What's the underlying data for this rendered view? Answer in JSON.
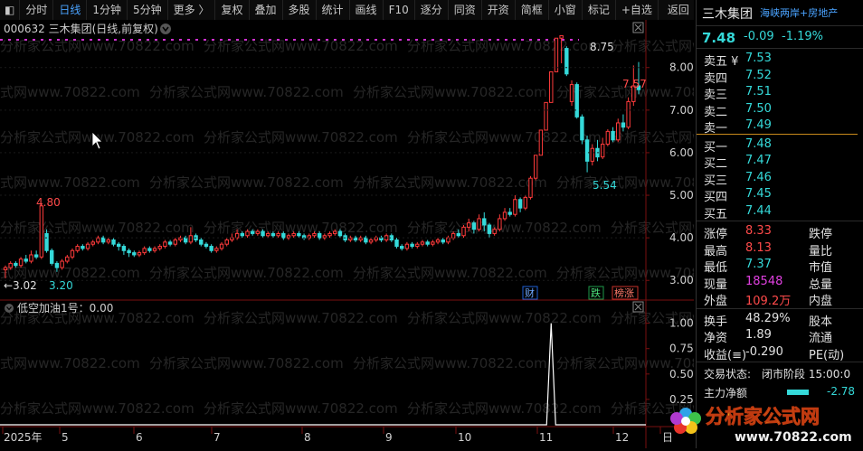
{
  "toolbar": {
    "items": [
      "分时",
      "日线",
      "1分钟",
      "5分钟",
      "更多 〉",
      "复权",
      "叠加",
      "多股",
      "统计",
      "画线",
      "F10",
      "逐分",
      "同资",
      "开资",
      "简框",
      "小窗",
      "标记",
      "+自选",
      "返回"
    ],
    "active": "日线"
  },
  "header": {
    "code_line": "000632 三木集团(日线,前复权)",
    "indicator_line": "低空加油1号：0.00"
  },
  "watermark": "分析家公式网www.70822.com",
  "chart_data": {
    "type": "candlestick",
    "price_axis": {
      "ticks": [
        "8.00",
        "7.00",
        "6.00",
        "5.00",
        "4.00",
        "3.00"
      ],
      "range": [
        2.75,
        8.95
      ]
    },
    "indicator_axis": {
      "ticks": [
        "1.00",
        "0.75",
        "0.50",
        "0.25"
      ],
      "range": [
        0,
        1.05
      ]
    },
    "x_labels": [
      "2025年",
      "5",
      "6",
      "7",
      "8",
      "9",
      "10",
      "11",
      "12",
      "日"
    ],
    "annotations": {
      "high": "8.75",
      "peak_low": "5.54",
      "last": "7.57",
      "early_high": "4.80",
      "early_low": "3.20",
      "left_low": "←3.02"
    },
    "event_tags": [
      {
        "text": "财",
        "color": "#1e5fd6"
      },
      {
        "text": "跌",
        "color": "#1e9a4a"
      },
      {
        "text": "榜涨",
        "color": "#c8322a"
      }
    ],
    "candles": [
      [
        3.25,
        3.3,
        3.05,
        3.35
      ],
      [
        3.3,
        3.4,
        3.25,
        3.45
      ],
      [
        3.4,
        3.35,
        3.3,
        3.45
      ],
      [
        3.35,
        3.5,
        3.3,
        3.55
      ],
      [
        3.5,
        3.45,
        3.4,
        3.6
      ],
      [
        3.45,
        3.6,
        3.4,
        3.7
      ],
      [
        3.6,
        3.55,
        3.5,
        3.7
      ],
      [
        3.55,
        4.75,
        3.5,
        4.8
      ],
      [
        4.1,
        3.7,
        3.65,
        4.2
      ],
      [
        3.7,
        3.4,
        3.35,
        3.75
      ],
      [
        3.4,
        3.3,
        3.2,
        3.45
      ],
      [
        3.3,
        3.45,
        3.25,
        3.5
      ],
      [
        3.45,
        3.55,
        3.4,
        3.6
      ],
      [
        3.55,
        3.7,
        3.5,
        3.75
      ],
      [
        3.7,
        3.8,
        3.65,
        3.85
      ],
      [
        3.8,
        3.75,
        3.7,
        3.85
      ],
      [
        3.75,
        3.85,
        3.7,
        3.9
      ],
      [
        3.85,
        3.9,
        3.8,
        3.95
      ],
      [
        3.9,
        4.0,
        3.85,
        4.05
      ],
      [
        4.0,
        3.9,
        3.85,
        4.05
      ],
      [
        3.9,
        3.95,
        3.85,
        4.0
      ],
      [
        3.95,
        3.85,
        3.8,
        4.0
      ],
      [
        3.85,
        3.8,
        3.7,
        3.9
      ],
      [
        3.8,
        3.7,
        3.6,
        3.85
      ],
      [
        3.7,
        3.65,
        3.55,
        3.75
      ],
      [
        3.65,
        3.6,
        3.55,
        3.7
      ],
      [
        3.6,
        3.65,
        3.55,
        3.7
      ],
      [
        3.65,
        3.75,
        3.6,
        3.8
      ],
      [
        3.75,
        3.7,
        3.65,
        3.8
      ],
      [
        3.7,
        3.75,
        3.65,
        3.8
      ],
      [
        3.75,
        3.8,
        3.7,
        3.85
      ],
      [
        3.8,
        3.9,
        3.75,
        3.95
      ],
      [
        3.9,
        3.85,
        3.8,
        3.95
      ],
      [
        3.85,
        3.95,
        3.8,
        4.0
      ],
      [
        3.95,
        4.0,
        3.9,
        4.05
      ],
      [
        4.0,
        3.9,
        3.85,
        4.05
      ],
      [
        3.9,
        4.05,
        3.85,
        4.25
      ],
      [
        4.05,
        3.95,
        3.9,
        4.1
      ],
      [
        3.95,
        3.85,
        3.8,
        4.0
      ],
      [
        3.85,
        3.8,
        3.75,
        3.9
      ],
      [
        3.8,
        3.7,
        3.65,
        3.85
      ],
      [
        3.7,
        3.75,
        3.65,
        3.8
      ],
      [
        3.75,
        3.85,
        3.7,
        3.9
      ],
      [
        3.85,
        3.95,
        3.8,
        4.0
      ],
      [
        3.95,
        4.0,
        3.9,
        4.1
      ],
      [
        4.0,
        4.1,
        3.95,
        4.2
      ],
      [
        4.1,
        4.05,
        4.0,
        4.15
      ],
      [
        4.05,
        4.15,
        4.0,
        4.2
      ],
      [
        4.15,
        4.1,
        4.05,
        4.2
      ],
      [
        4.1,
        4.15,
        4.05,
        4.2
      ],
      [
        4.15,
        4.05,
        4.0,
        4.2
      ],
      [
        4.05,
        4.1,
        4.0,
        4.15
      ],
      [
        4.1,
        4.05,
        4.0,
        4.15
      ],
      [
        4.05,
        4.1,
        4.0,
        4.15
      ],
      [
        4.1,
        4.0,
        3.95,
        4.15
      ],
      [
        4.0,
        4.05,
        3.95,
        4.1
      ],
      [
        4.05,
        4.1,
        4.0,
        4.15
      ],
      [
        4.1,
        4.05,
        4.0,
        4.15
      ],
      [
        4.05,
        4.0,
        3.95,
        4.1
      ],
      [
        4.0,
        4.05,
        3.95,
        4.1
      ],
      [
        4.05,
        4.1,
        4.0,
        4.15
      ],
      [
        4.1,
        4.0,
        3.95,
        4.15
      ],
      [
        4.0,
        4.05,
        3.95,
        4.1
      ],
      [
        4.05,
        4.1,
        4.0,
        4.15
      ],
      [
        4.1,
        4.15,
        4.05,
        4.2
      ],
      [
        4.15,
        4.05,
        4.0,
        4.2
      ],
      [
        4.05,
        3.95,
        3.9,
        4.1
      ],
      [
        3.95,
        4.0,
        3.9,
        4.05
      ],
      [
        4.0,
        3.95,
        3.9,
        4.05
      ],
      [
        3.95,
        4.0,
        3.9,
        4.05
      ],
      [
        4.0,
        3.9,
        3.85,
        4.05
      ],
      [
        3.9,
        3.95,
        3.85,
        4.0
      ],
      [
        3.95,
        4.0,
        3.9,
        4.05
      ],
      [
        4.0,
        3.95,
        3.9,
        4.05
      ],
      [
        3.95,
        4.05,
        3.9,
        4.1
      ],
      [
        4.05,
        3.95,
        3.9,
        4.1
      ],
      [
        3.95,
        3.8,
        3.75,
        4.0
      ],
      [
        3.8,
        3.75,
        3.7,
        3.85
      ],
      [
        3.75,
        3.85,
        3.7,
        3.9
      ],
      [
        3.85,
        3.8,
        3.75,
        3.9
      ],
      [
        3.8,
        3.85,
        3.75,
        3.9
      ],
      [
        3.85,
        3.9,
        3.8,
        3.95
      ],
      [
        3.9,
        3.85,
        3.8,
        3.95
      ],
      [
        3.85,
        3.9,
        3.8,
        3.95
      ],
      [
        3.9,
        3.95,
        3.85,
        4.0
      ],
      [
        3.95,
        3.9,
        3.85,
        4.0
      ],
      [
        3.9,
        4.0,
        3.85,
        4.05
      ],
      [
        4.0,
        4.1,
        3.95,
        4.15
      ],
      [
        4.1,
        4.05,
        4.0,
        4.2
      ],
      [
        4.05,
        4.25,
        4.0,
        4.3
      ],
      [
        4.25,
        4.35,
        4.15,
        4.45
      ],
      [
        4.35,
        4.2,
        4.1,
        4.4
      ],
      [
        4.2,
        4.45,
        4.15,
        4.55
      ],
      [
        4.45,
        4.3,
        4.15,
        4.6
      ],
      [
        4.3,
        4.1,
        4.0,
        4.35
      ],
      [
        4.1,
        4.2,
        4.05,
        4.25
      ],
      [
        4.2,
        4.45,
        4.15,
        4.55
      ],
      [
        4.45,
        4.6,
        4.4,
        4.7
      ],
      [
        4.6,
        4.55,
        4.5,
        4.7
      ],
      [
        4.55,
        4.9,
        4.5,
        5.0
      ],
      [
        4.9,
        4.7,
        4.6,
        4.95
      ],
      [
        4.7,
        4.95,
        4.65,
        5.0
      ],
      [
        4.95,
        5.4,
        4.9,
        5.45
      ],
      [
        5.4,
        5.94,
        5.35,
        5.94
      ],
      [
        5.94,
        6.53,
        5.94,
        6.53
      ],
      [
        6.53,
        7.18,
        6.53,
        7.18
      ],
      [
        7.18,
        7.9,
        7.18,
        7.9
      ],
      [
        7.9,
        8.69,
        7.9,
        8.69
      ],
      [
        8.69,
        8.75,
        8.1,
        8.75
      ],
      [
        8.45,
        7.85,
        7.8,
        8.5
      ],
      [
        7.2,
        7.6,
        7.1,
        7.7
      ],
      [
        7.6,
        6.84,
        6.8,
        7.65
      ],
      [
        6.84,
        6.3,
        6.2,
        6.9
      ],
      [
        6.3,
        5.8,
        5.54,
        6.4
      ],
      [
        5.8,
        6.1,
        5.7,
        6.2
      ],
      [
        6.1,
        5.9,
        5.8,
        6.3
      ],
      [
        5.9,
        6.2,
        5.85,
        6.35
      ],
      [
        6.2,
        6.5,
        6.15,
        6.55
      ],
      [
        6.5,
        6.3,
        6.25,
        6.6
      ],
      [
        6.3,
        6.7,
        6.25,
        6.8
      ],
      [
        6.7,
        6.6,
        6.5,
        6.9
      ],
      [
        6.6,
        7.2,
        6.55,
        7.3
      ],
      [
        7.2,
        7.57,
        7.1,
        8.05
      ],
      [
        7.57,
        7.48,
        7.37,
        8.13
      ]
    ],
    "indicator": {
      "name": "低空加油1号",
      "spike_index": 106,
      "spike_value": 1.0,
      "baseline": 0.0
    }
  },
  "quote": {
    "name": "三木集团",
    "sector": "海峡两岸+房地产",
    "price": "7.48",
    "change": "-0.09",
    "pct": "-1.19%",
    "sell": [
      {
        "label": "卖五 ¥",
        "price": "7.53"
      },
      {
        "label": "卖四",
        "price": "7.52"
      },
      {
        "label": "卖三",
        "price": "7.51"
      },
      {
        "label": "卖二",
        "price": "7.50"
      },
      {
        "label": "卖一",
        "price": "7.49"
      }
    ],
    "buy": [
      {
        "label": "买一",
        "price": "7.48"
      },
      {
        "label": "买二",
        "price": "7.47"
      },
      {
        "label": "买三",
        "price": "7.46"
      },
      {
        "label": "买四",
        "price": "7.45"
      },
      {
        "label": "买五",
        "price": "7.44"
      }
    ],
    "stats1": [
      {
        "l": "涨停",
        "v": "8.33",
        "r": "跌停"
      },
      {
        "l": "最高",
        "v": "8.13",
        "r": "量比"
      },
      {
        "l": "最低",
        "v": "7.37",
        "r": "市值"
      },
      {
        "l": "现量",
        "v": "18548",
        "r": "总量"
      },
      {
        "l": "外盘",
        "v": "109.2万",
        "r": "内盘"
      }
    ],
    "stats2": [
      {
        "l": "换手",
        "v": "48.29%",
        "r": "股本"
      },
      {
        "l": "净资",
        "v": "1.89",
        "r": "流通"
      },
      {
        "l": "收益(≡)",
        "v": "-0.290",
        "r": "PE(动)"
      }
    ],
    "trade_status_label": "交易状态:",
    "trade_status": "闭市阶段 15:00:0",
    "main_net_label": "主力净额",
    "main_net_value": "-2.78"
  },
  "logo": {
    "text": "分析家公式网",
    "url_text": "www.70822.com"
  }
}
